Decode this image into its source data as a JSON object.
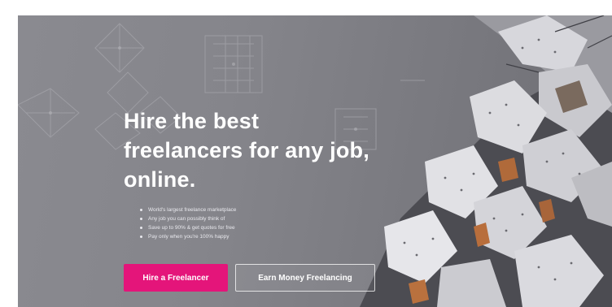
{
  "hero": {
    "headline_lines": [
      "Hire the best",
      "freelancers for any job,",
      "online."
    ],
    "bullets": [
      "World's largest freelance marketplace",
      "Any job you can possibly think of",
      "Save up to 90% & get quotes for free",
      "Pay only when you're 100% happy"
    ]
  },
  "actions": {
    "hire_label": "Hire a Freelancer",
    "earn_label": "Earn Money Freelancing"
  },
  "colors": {
    "accent": "#e4157a",
    "overlay": "#85858b",
    "text": "#ffffff"
  }
}
